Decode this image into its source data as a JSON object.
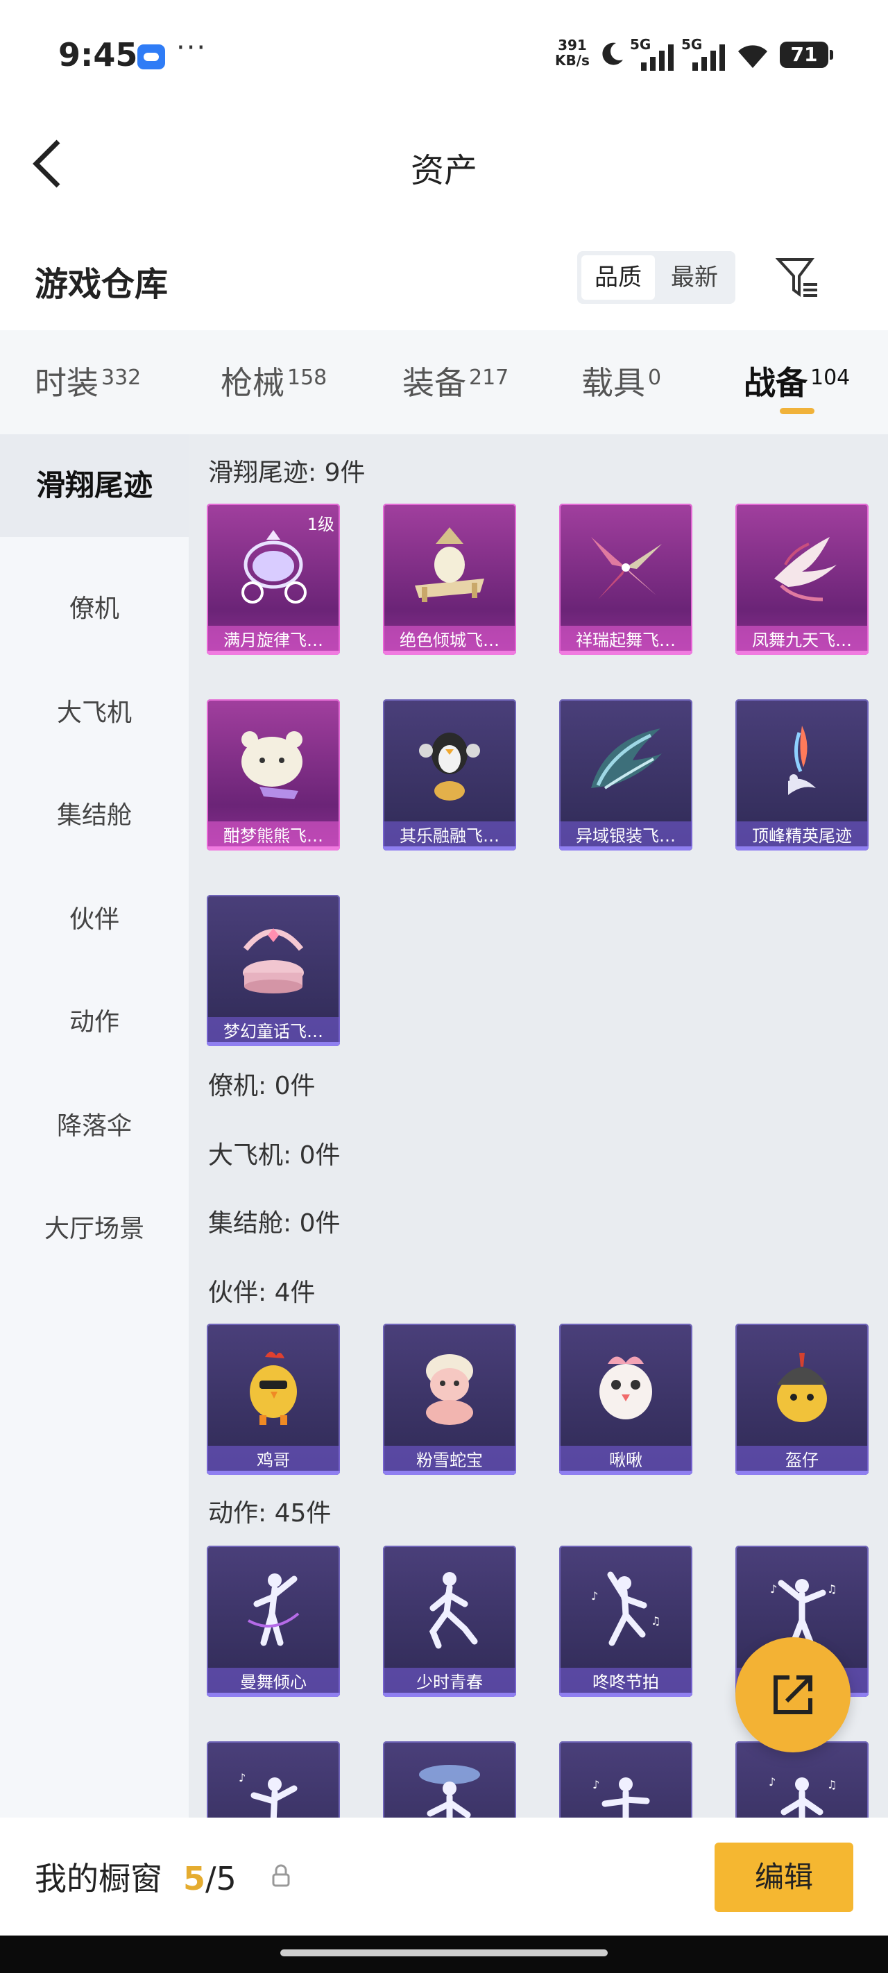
{
  "status_bar": {
    "time": "9:45",
    "net_speed_value": "391",
    "net_speed_unit": "KB/s",
    "battery": "71",
    "signal_1_label": "5G",
    "signal_2_label": "5G"
  },
  "header": {
    "title": "资产"
  },
  "section": {
    "title": "游戏仓库",
    "sort_options": [
      "品质",
      "最新"
    ],
    "sort_selected": "品质"
  },
  "tabs": [
    {
      "label": "时装",
      "count": "332"
    },
    {
      "label": "枪械",
      "count": "158"
    },
    {
      "label": "装备",
      "count": "217"
    },
    {
      "label": "载具",
      "count": "0"
    },
    {
      "label": "战备",
      "count": "104"
    }
  ],
  "active_tab": "战备",
  "sidebar": [
    "滑翔尾迹",
    "僚机",
    "大飞机",
    "集结舱",
    "伙伴",
    "动作",
    "降落伞",
    "大厅场景"
  ],
  "groups": {
    "glide": {
      "title": "滑翔尾迹: 9件",
      "items": [
        {
          "name": "满月旋律飞…",
          "level": "1级"
        },
        {
          "name": "绝色倾城飞…"
        },
        {
          "name": "祥瑞起舞飞…"
        },
        {
          "name": "凤舞九天飞…"
        },
        {
          "name": "酣梦熊熊飞…"
        },
        {
          "name": "其乐融融飞…"
        },
        {
          "name": "异域银装飞…"
        },
        {
          "name": "顶峰精英尾迹"
        },
        {
          "name": "梦幻童话飞…"
        }
      ]
    },
    "wingman": {
      "title": "僚机: 0件"
    },
    "plane": {
      "title": "大飞机: 0件"
    },
    "pod": {
      "title": "集结舱: 0件"
    },
    "partner": {
      "title": "伙伴: 4件",
      "items": [
        {
          "name": "鸡哥"
        },
        {
          "name": "粉雪蛇宝"
        },
        {
          "name": "啾啾"
        },
        {
          "name": "盔仔"
        }
      ]
    },
    "emote": {
      "title": "动作: 45件",
      "items": [
        {
          "name": "曼舞倾心"
        },
        {
          "name": "少时青春"
        },
        {
          "name": "咚咚节拍"
        },
        {
          "name": ""
        }
      ]
    }
  },
  "bottom": {
    "label": "我的橱窗",
    "count_current": "5",
    "count_sep_total": "/5",
    "edit": "编辑"
  }
}
